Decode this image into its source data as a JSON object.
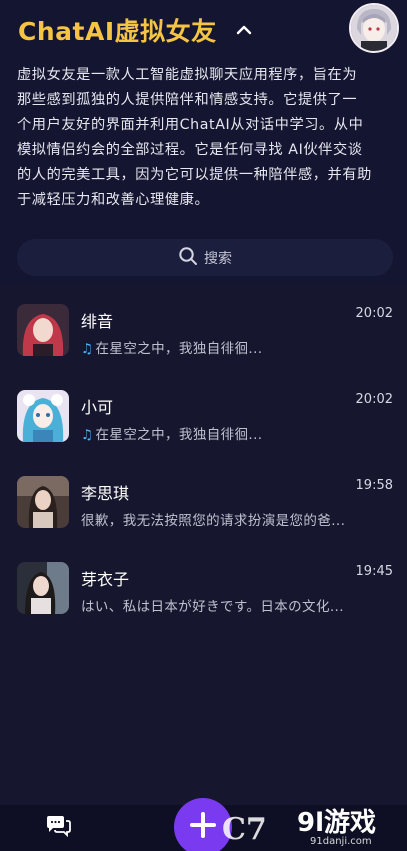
{
  "header": {
    "app_title": "ChatAI虚拟女友",
    "chevron_icon": "chevron-up-icon",
    "avatar_icon": "profile-avatar"
  },
  "description": {
    "lines": [
      "虚拟女友是一款人工智能虚拟聊天应用程序，旨在为",
      "那些感到孤独的人提供陪伴和情感支持。它提供了一",
      "个用户友好的界面并利用ChatAI从对话中学习。从中",
      "模拟情侣约会的全部过程。它是任何寻找 AI伙伴交谈",
      "的人的完美工具，因为它可以提供一种陪伴感，并有助",
      "于减轻压力和改善心理健康。"
    ]
  },
  "search": {
    "label": "搜索",
    "icon": "search-icon"
  },
  "chats": [
    {
      "name": "绯音",
      "time": "20:02",
      "preview": "在星空之中，我独自徘徊...",
      "has_music_icon": true,
      "avatar_colors": [
        "#c0394a",
        "#3b2a3a"
      ]
    },
    {
      "name": "小可",
      "time": "20:02",
      "preview": "在星空之中，我独自徘徊...",
      "has_music_icon": true,
      "avatar_colors": [
        "#4bb0d8",
        "#e9e3f2"
      ]
    },
    {
      "name": "李思琪",
      "time": "19:58",
      "preview": "很歉，我无法按照您的请求扮演是您的爸...",
      "has_music_icon": false,
      "avatar_colors": [
        "#d9c8bd",
        "#4a3c38"
      ]
    },
    {
      "name": "芽衣子",
      "time": "19:45",
      "preview": "はい、私は日本が好きです。日本の文化...",
      "has_music_icon": false,
      "avatar_colors": [
        "#6e7b8a",
        "#2a2f3a"
      ]
    }
  ],
  "music_icon": "music-note-icon",
  "bottom_nav": {
    "chat_icon": "chat-bubbles-icon",
    "fab_icon": "plus-icon"
  },
  "watermark": {
    "left_text": "C7",
    "right_text": "9l游戏",
    "url": "91danji.com"
  },
  "colors": {
    "background": "#16172f",
    "title": "#f6c445",
    "accent": "#7a3bf0",
    "music_note": "#4fb3f5"
  }
}
